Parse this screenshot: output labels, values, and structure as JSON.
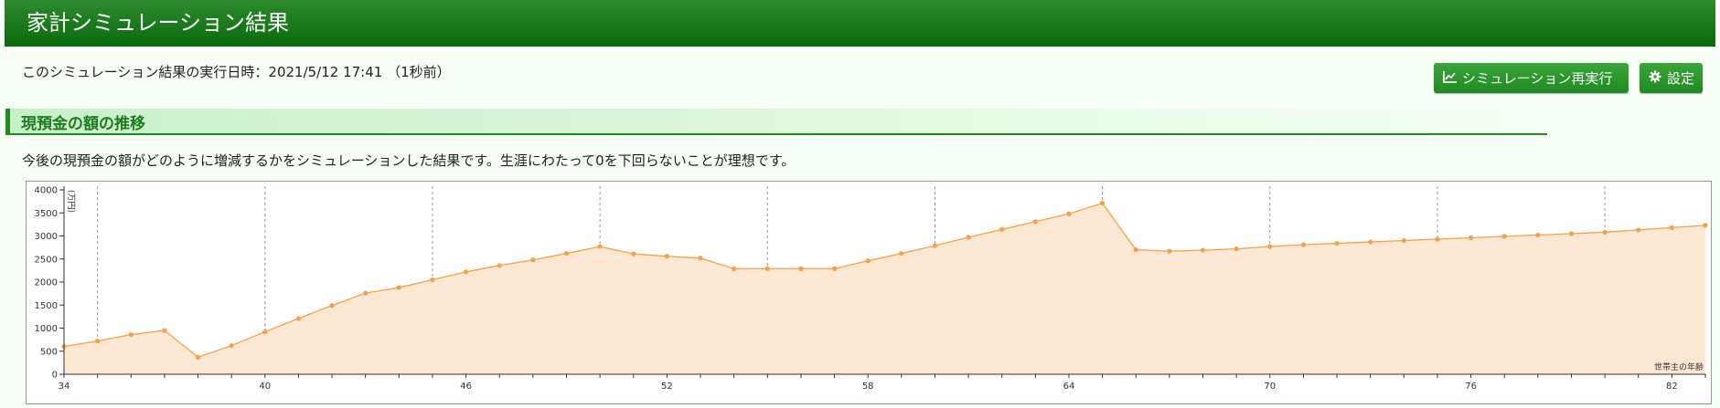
{
  "header": {
    "title": "家計シミュレーション結果"
  },
  "exec_text": "このシミュレーション結果の実行日時：2021/5/12 17:41 （1秒前）",
  "buttons": {
    "rerun_label": "シミュレーション再実行",
    "settings_label": "設定"
  },
  "icons": {
    "rerun": "chart-line-icon",
    "settings": "gear-icon"
  },
  "section": {
    "title": "現預金の額の推移",
    "description": "今後の現預金の額がどのように増減するかをシミュレーションした結果です。生涯にわたって0を下回らないことが理想です。"
  },
  "colors": {
    "accent": "#1f8a1f",
    "line": "#f5a04b",
    "fill": "#fde8d4"
  },
  "chart_data": {
    "type": "area",
    "ylabel": "(万円)",
    "xlabel": "世帯主の年齢",
    "ylim": [
      0,
      4000
    ],
    "xlim": [
      34,
      83
    ],
    "y_ticks": [
      0,
      500,
      1000,
      1500,
      2000,
      2500,
      3000,
      3500,
      4000
    ],
    "x_ticks": [
      34,
      40,
      46,
      52,
      58,
      64,
      70,
      76,
      82
    ],
    "vertical_gridlines": [
      35,
      40,
      45,
      50,
      55,
      60,
      65,
      70,
      75,
      80
    ],
    "x": [
      34,
      35,
      36,
      37,
      38,
      39,
      40,
      41,
      42,
      43,
      44,
      45,
      46,
      47,
      48,
      49,
      50,
      51,
      52,
      53,
      54,
      55,
      56,
      57,
      58,
      59,
      60,
      61,
      62,
      63,
      64,
      65,
      66,
      67,
      68,
      69,
      70,
      71,
      72,
      73,
      74,
      75,
      76,
      77,
      78,
      79,
      80,
      81,
      82,
      83
    ],
    "values": [
      600,
      720,
      860,
      950,
      370,
      620,
      920,
      1210,
      1490,
      1760,
      1880,
      2050,
      2220,
      2360,
      2480,
      2620,
      2770,
      2610,
      2560,
      2520,
      2290,
      2290,
      2290,
      2290,
      2460,
      2620,
      2790,
      2970,
      3140,
      3310,
      3480,
      3710,
      2700,
      2670,
      2690,
      2720,
      2770,
      2810,
      2840,
      2870,
      2900,
      2930,
      2960,
      2990,
      3020,
      3050,
      3080,
      3130,
      3180,
      3230
    ]
  }
}
